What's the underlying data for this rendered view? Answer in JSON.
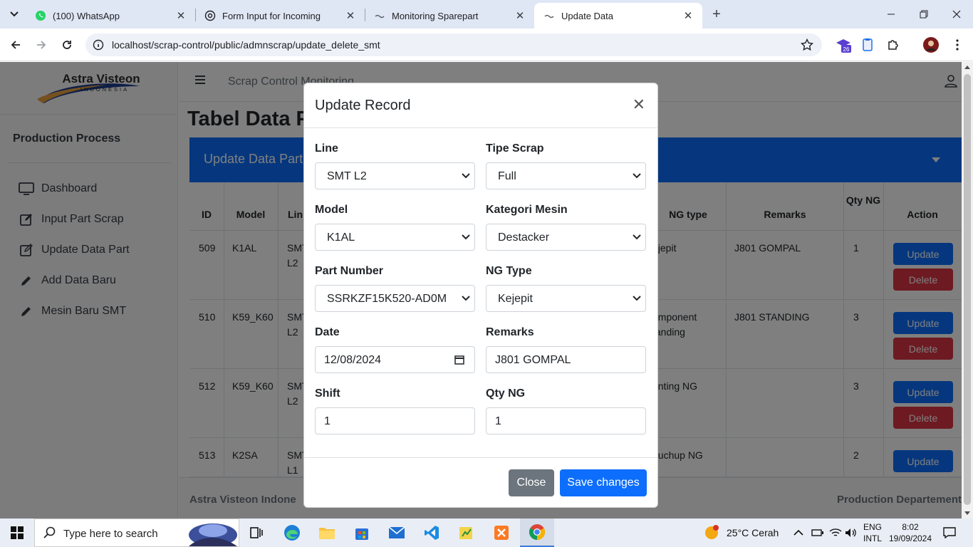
{
  "browser": {
    "tabs": [
      {
        "title": "(100) WhatsApp",
        "favicon": "whatsapp-icon"
      },
      {
        "title": "Form Input for Incoming",
        "favicon": "openai-icon"
      },
      {
        "title": "Monitoring Sparepart",
        "favicon": "page-icon"
      },
      {
        "title": "Update Data",
        "favicon": "page-icon",
        "active": true
      }
    ],
    "url": "localhost/scrap-control/public/admnscrap/update_delete_smt",
    "extension_badge": "26"
  },
  "sidebar": {
    "brand_line1": "Astra Visteon",
    "brand_line2": "INDONESIA",
    "heading": "Production Process",
    "items": [
      {
        "label": "Dashboard",
        "icon": "monitor-icon"
      },
      {
        "label": "Input Part Scrap",
        "icon": "edit-icon"
      },
      {
        "label": "Update Data Part",
        "icon": "edit-icon"
      },
      {
        "label": "Add Data Baru",
        "icon": "pencil-icon"
      },
      {
        "label": "Mesin Baru SMT",
        "icon": "pencil-icon"
      }
    ]
  },
  "topnav": {
    "brand": "Scrap Control Monitoring"
  },
  "main": {
    "title": "Tabel Data P",
    "card_title": "Update Data Part S",
    "table": {
      "headers": {
        "id": "ID",
        "model": "Model",
        "line": "Lin",
        "ng_type": "NG type",
        "remarks": "Remarks",
        "qty": "Qty NG",
        "action": "Action"
      },
      "rows": [
        {
          "id": "509",
          "model": "K1AL",
          "line": "SMT L2",
          "ng_type": "ejepit",
          "remarks": "J801 GOMPAL",
          "qty": "1"
        },
        {
          "id": "510",
          "model": "K59_K60",
          "line": "SMT L2",
          "ng_type": "omponent tanding",
          "remarks": "J801 STANDING",
          "qty": "3"
        },
        {
          "id": "512",
          "model": "K59_K60",
          "line": "SMT L2",
          "ng_type": "rinting NG",
          "remarks": "",
          "qty": "3"
        },
        {
          "id": "513",
          "model": "K2SA",
          "line": "SMT L1",
          "ng_type": "ouchup NG",
          "remarks": "",
          "qty": "2"
        }
      ],
      "update_label": "Update",
      "delete_label": "Delete"
    },
    "footer_left": "Astra Visteon Indone",
    "footer_right": "Production Departement"
  },
  "modal": {
    "title": "Update Record",
    "fields": {
      "line": {
        "label": "Line",
        "value": "SMT L2"
      },
      "tipe_scrap": {
        "label": "Tipe Scrap",
        "value": "Full"
      },
      "model": {
        "label": "Model",
        "value": "K1AL"
      },
      "kategori_mesin": {
        "label": "Kategori Mesin",
        "value": "Destacker"
      },
      "part_number": {
        "label": "Part Number",
        "value": "SSRKZF15K520-AD0M"
      },
      "ng_type": {
        "label": "NG Type",
        "value": "Kejepit"
      },
      "date": {
        "label": "Date",
        "value": "12/08/2024"
      },
      "remarks": {
        "label": "Remarks",
        "value": "J801 GOMPAL"
      },
      "shift": {
        "label": "Shift",
        "value": "1"
      },
      "qty_ng": {
        "label": "Qty NG",
        "value": "1"
      }
    },
    "close_label": "Close",
    "save_label": "Save changes"
  },
  "taskbar": {
    "search_placeholder": "Type here to search",
    "weather": "25°C  Cerah",
    "lang1": "ENG",
    "lang2": "INTL",
    "time": "8:02",
    "date": "19/09/2024"
  }
}
